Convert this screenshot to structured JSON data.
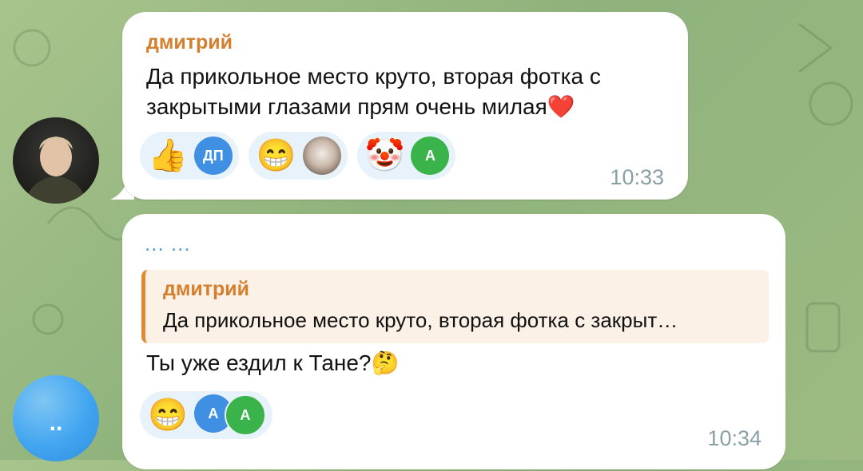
{
  "messages": [
    {
      "sender": "дмитрий",
      "text_line1": "Да прикольное место круто, вторая фотка с",
      "text_line2": "закрытыми глазами прям очень милая❤️",
      "time": "10:33",
      "reactions": [
        {
          "emoji": "👍",
          "avatars": [
            "ДП"
          ]
        },
        {
          "emoji": "😁",
          "avatars": [
            ""
          ]
        },
        {
          "emoji": "🤡",
          "avatars": [
            "А"
          ]
        }
      ]
    },
    {
      "sender": "... ...",
      "reply_sender": "дмитрий",
      "reply_text": "Да прикольное место круто, вторая фотка с закрыт…",
      "text": "Ты уже ездил к Тане?🤔",
      "time": "10:34",
      "reactions": [
        {
          "emoji": "😁",
          "avatars": [
            "А",
            "А"
          ]
        }
      ]
    }
  ],
  "avatar_initials": ".."
}
